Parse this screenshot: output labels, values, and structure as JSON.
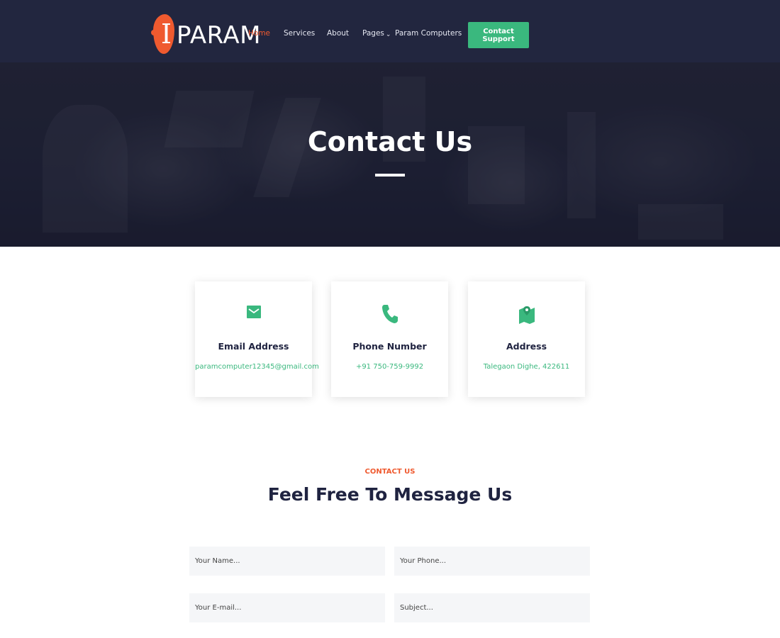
{
  "brand": {
    "logo_text": "PARAM",
    "accent": "#ef5a2f"
  },
  "nav": {
    "items": [
      {
        "label": "Home",
        "active": true
      },
      {
        "label": "Services"
      },
      {
        "label": "About"
      },
      {
        "label": "Pages",
        "has_dropdown": true
      },
      {
        "label": "Param Computers"
      }
    ],
    "cta_label": "Contact Support",
    "cta_color": "#3ab87e"
  },
  "hero": {
    "title": "Contact Us"
  },
  "contact_cards": [
    {
      "icon": "envelope-icon",
      "title": "Email Address",
      "value": "paramcomputer12345@gmail.com"
    },
    {
      "icon": "phone-icon",
      "title": "Phone Number",
      "value": "+91 750-759-9992"
    },
    {
      "icon": "map-pin-icon",
      "title": "Address",
      "value": "Talegaon Dighe, 422611"
    }
  ],
  "section": {
    "kicker": "CONTACT US",
    "title": "Feel Free To Message Us"
  },
  "form": {
    "name_placeholder": "Your Name...",
    "phone_placeholder": "Your Phone...",
    "email_placeholder": "Your E-mail...",
    "subject_placeholder": "Subject..."
  },
  "colors": {
    "navy": "#22263f",
    "green": "#3ab87e",
    "orange": "#ef5a2f"
  }
}
